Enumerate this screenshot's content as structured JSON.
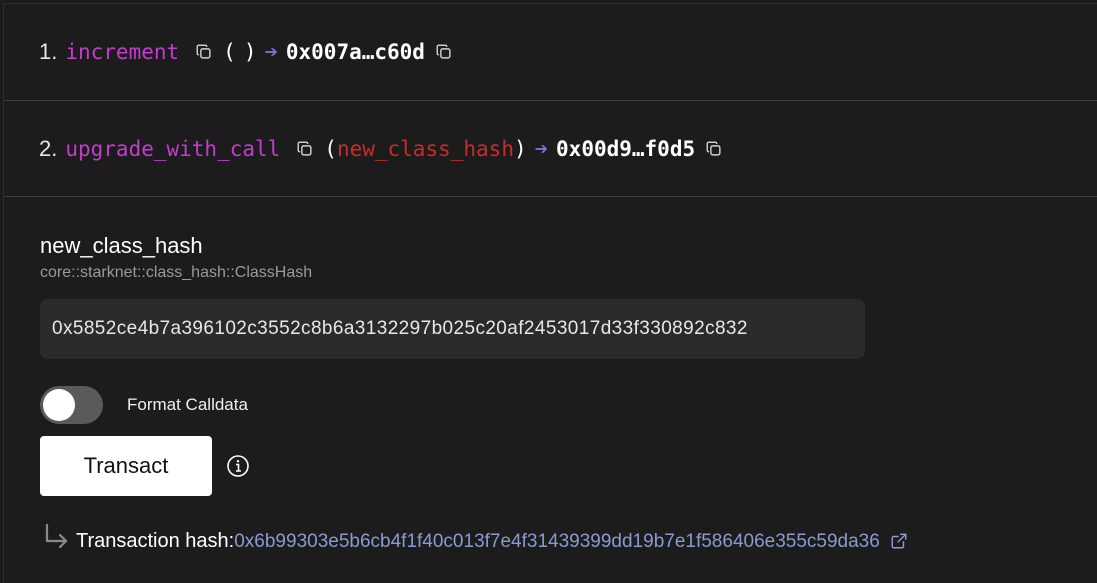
{
  "functions": [
    {
      "index": "1.",
      "name": "increment",
      "open_paren": "(",
      "params": "",
      "close_paren": ")",
      "arrow": "➔",
      "result_hash": "0x007a…c60d"
    },
    {
      "index": "2.",
      "name": "upgrade_with_call",
      "open_paren": "(",
      "params": "new_class_hash",
      "close_paren": ")",
      "arrow": "➔",
      "result_hash": "0x00d9…f0d5"
    }
  ],
  "form": {
    "field_label": "new_class_hash",
    "field_type": "core::starknet::class_hash::ClassHash",
    "input_value": "0x5852ce4b7a396102c3552c8b6a3132297b025c20af2453017d33f330892c832",
    "toggle_label": "Format Calldata",
    "toggle_on": false,
    "transact_label": "Transact"
  },
  "transaction": {
    "label": "Transaction hash:",
    "hash": "0x6b99303e5b6cb4f1f40c013f7e4f31439399dd19b7e1f586406e355c59da36"
  },
  "colors": {
    "background": "#1c1c1c",
    "function_name": "#c53bd0",
    "param": "#cc2a2a",
    "arrow": "#8a6bd8",
    "link": "#8a9ad0"
  },
  "icons": {
    "copy": "copy-icon",
    "info": "info-icon",
    "return": "return-arrow-icon",
    "external": "external-link-icon"
  }
}
